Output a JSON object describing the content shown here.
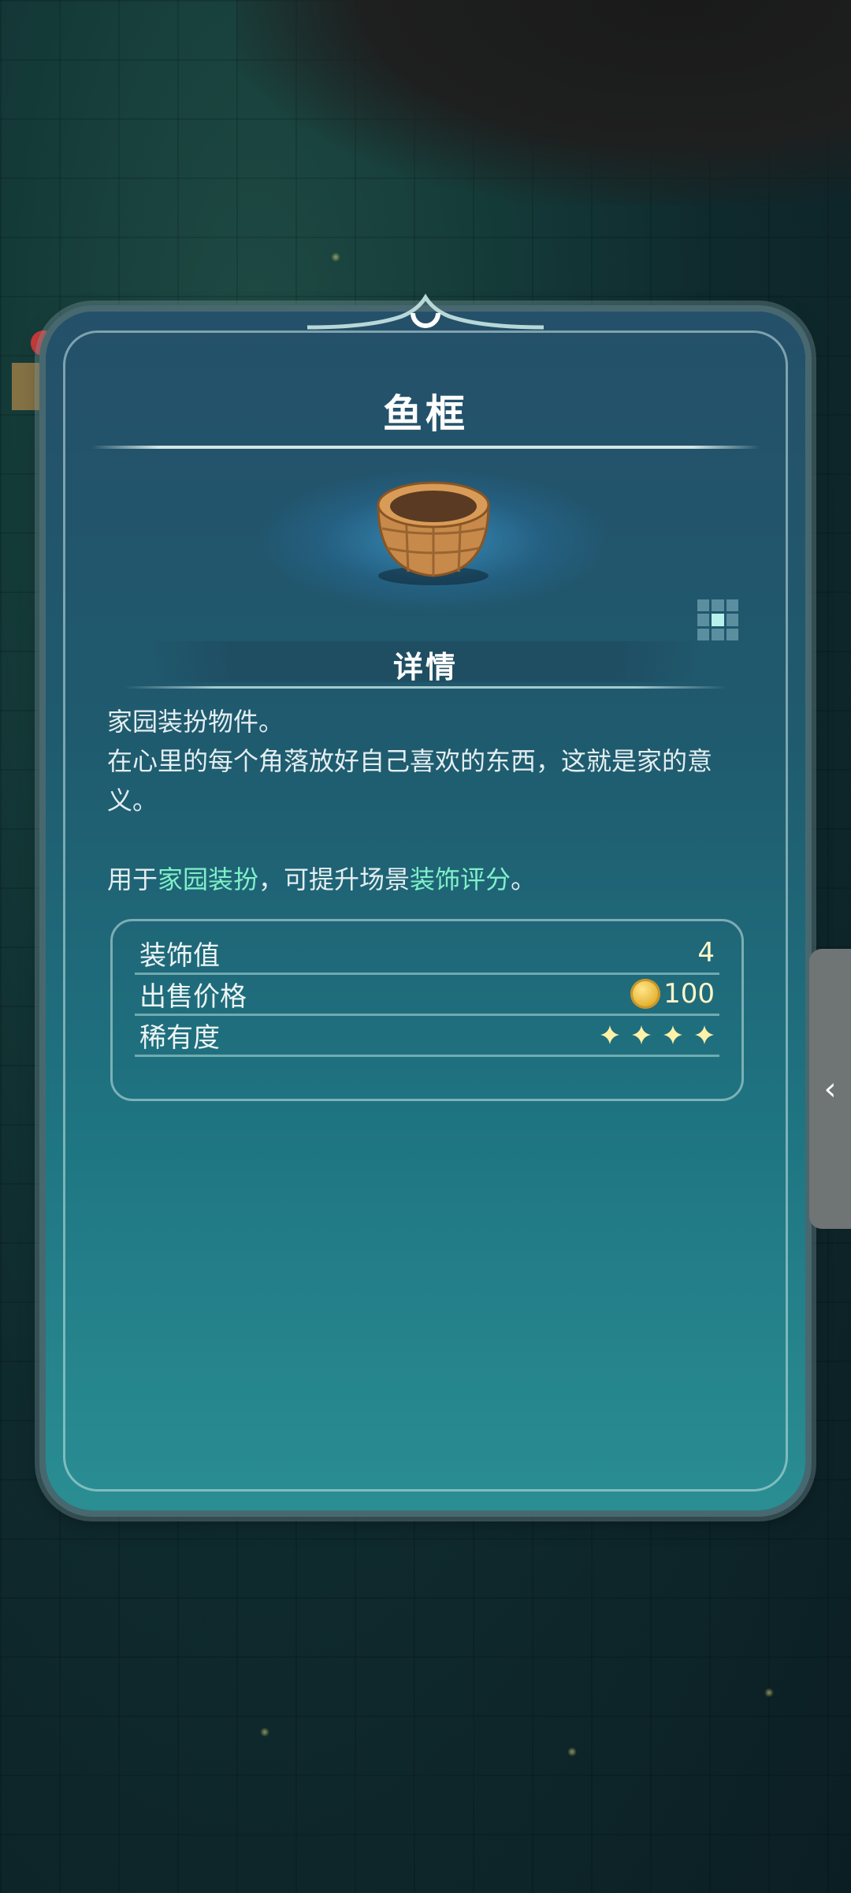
{
  "item": {
    "title": "鱼框",
    "section_title": "详情",
    "description": {
      "line1": "家园装扮物件。",
      "line2": "在心里的每个角落放好自己喜欢的东西，这就是家的意义。",
      "usage_prefix": "用于",
      "usage_highlight1": "家园装扮",
      "usage_middle": "，可提升场景",
      "usage_highlight2": "装饰评分",
      "usage_suffix": "。"
    },
    "stats": [
      {
        "label": "装饰值",
        "value": "4"
      },
      {
        "label": "出售价格",
        "value": "100",
        "icon": "gold-coin-icon"
      },
      {
        "label": "稀有度",
        "rarity_stars": 4
      }
    ]
  },
  "colors": {
    "highlight": "#7ff0c8",
    "value": "#fff6c8",
    "rarity_star": "#fff2a8"
  },
  "side_tab": {
    "icon": "chevron-left-icon",
    "glyph": "‹"
  }
}
